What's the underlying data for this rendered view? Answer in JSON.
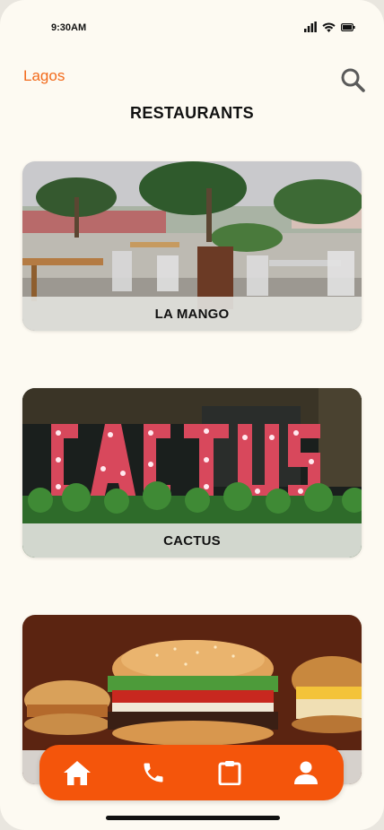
{
  "status_bar": {
    "time": "9:30AM"
  },
  "header": {
    "location": "Lagos",
    "title": "RESTAURANTS"
  },
  "restaurants": [
    {
      "name": "LA MANGO"
    },
    {
      "name": "CACTUS"
    },
    {
      "name": ""
    }
  ],
  "icons": {
    "search": "search-icon",
    "nav": [
      "home-icon",
      "phone-icon",
      "clipboard-icon",
      "user-icon"
    ]
  },
  "colors": {
    "accent": "#f4550b",
    "location_text": "#f26a1b",
    "background": "#fdfaf2"
  }
}
